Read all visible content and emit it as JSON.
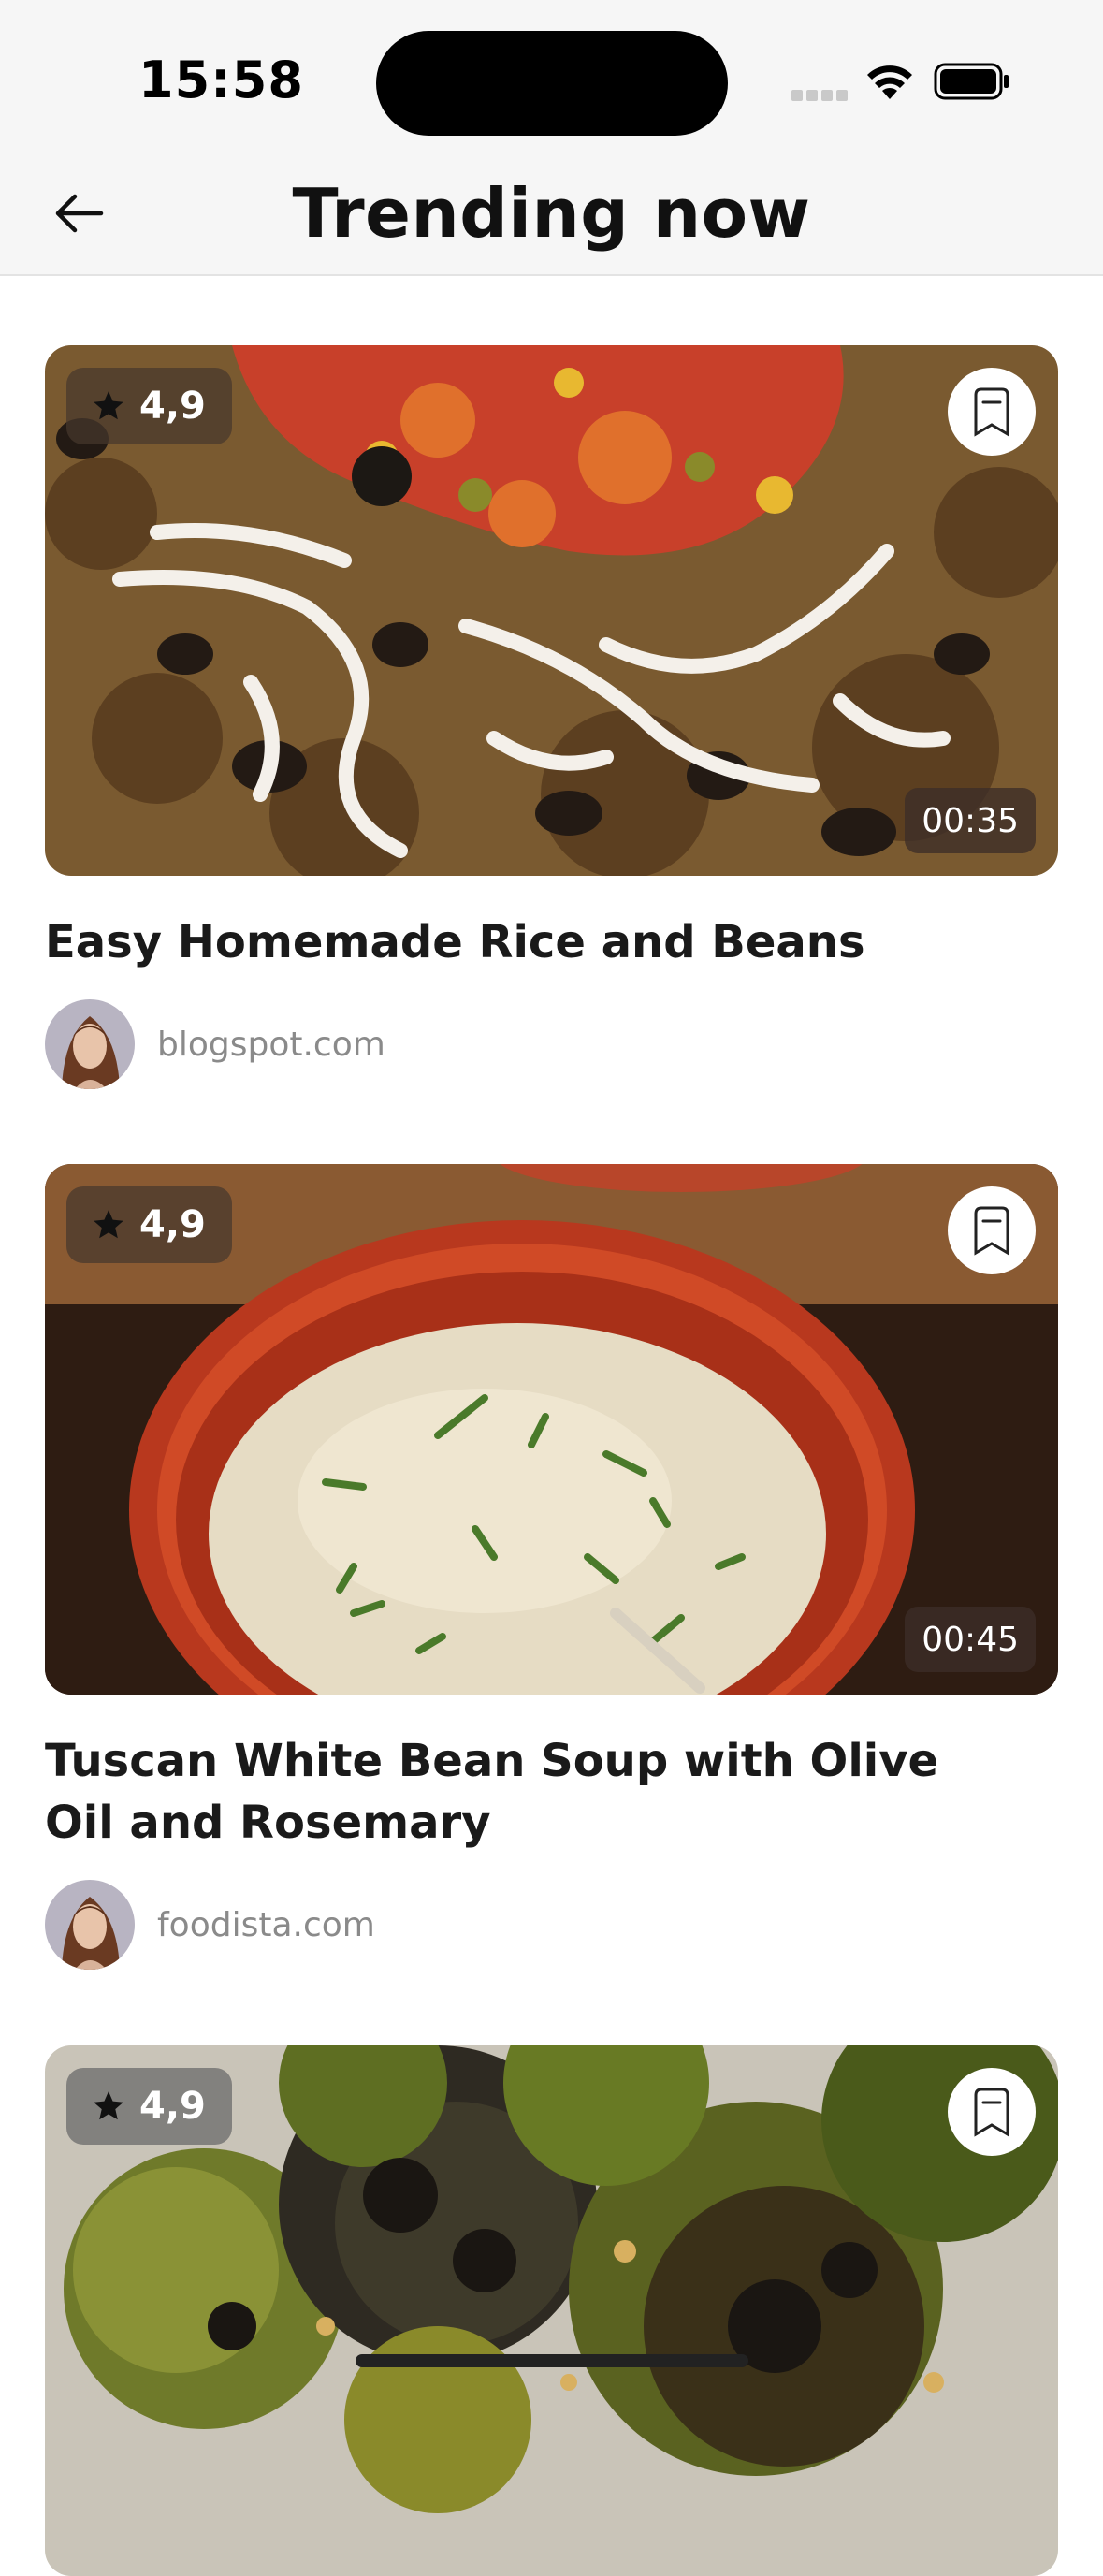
{
  "status_bar": {
    "time": "15:58",
    "wifi_icon": "wifi-icon",
    "battery_icon": "battery-icon"
  },
  "header": {
    "back_icon": "arrow-left-icon",
    "title": "Trending now"
  },
  "recipes": [
    {
      "rating": "4,9",
      "duration": "00:35",
      "title": "Easy Homemade Rice and Beans",
      "source": "blogspot.com"
    },
    {
      "rating": "4,9",
      "duration": "00:45",
      "title": "Tuscan White Bean Soup with Olive Oil and Rosemary",
      "source": "foodista.com"
    },
    {
      "rating": "4,9"
    }
  ],
  "icons": {
    "rating": "star-icon",
    "bookmark": "bookmark-icon"
  },
  "colors": {
    "background": "#ffffff",
    "header_background": "#f6f6f6",
    "title_text": "#111111",
    "source_text": "#8a8a8a"
  }
}
